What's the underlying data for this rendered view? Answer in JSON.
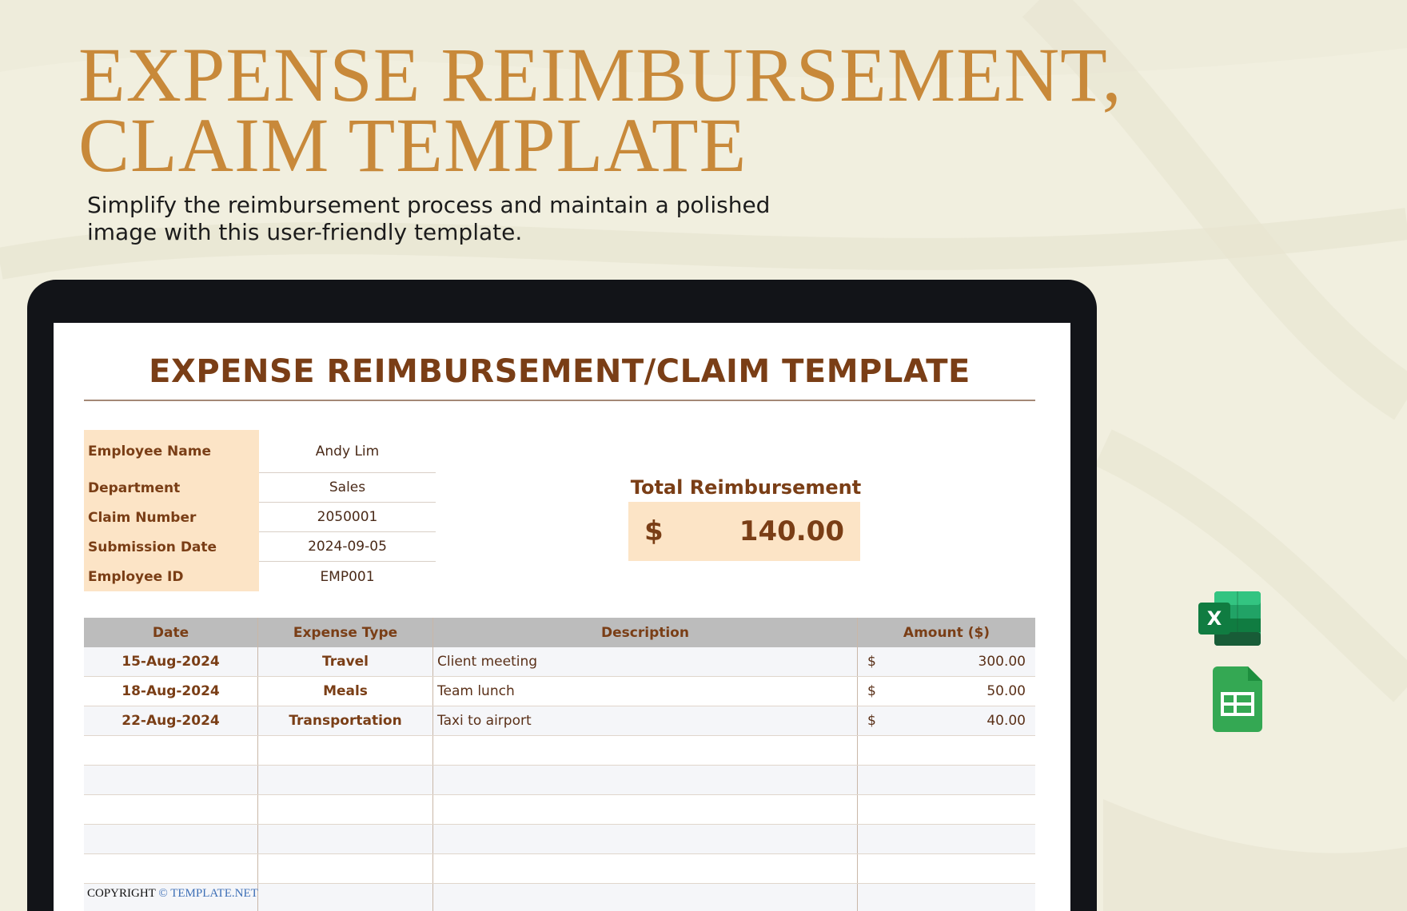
{
  "hero": {
    "title_line1": "EXPENSE REIMBURSEMENT,",
    "title_line2": "CLAIM TEMPLATE",
    "subtitle": "Simplify the reimbursement process and maintain a polished image with this user-friendly template."
  },
  "sheet": {
    "title": "EXPENSE REIMBURSEMENT/CLAIM TEMPLATE",
    "info": [
      {
        "label": "Employee Name",
        "value": "Andy Lim"
      },
      {
        "label": "Department",
        "value": "Sales"
      },
      {
        "label": "Claim Number",
        "value": "2050001"
      },
      {
        "label": "Submission Date",
        "value": "2024-09-05"
      },
      {
        "label": "Employee ID",
        "value": "EMP001"
      }
    ],
    "total": {
      "label": "Total Reimbursement",
      "currency": "$",
      "amount": "140.00"
    },
    "table": {
      "headers": [
        "Date",
        "Expense Type",
        "Description",
        "Amount ($)"
      ],
      "rows": [
        {
          "date": "15-Aug-2024",
          "type": "Travel",
          "description": "Client meeting",
          "currency": "$",
          "amount": "300.00"
        },
        {
          "date": "18-Aug-2024",
          "type": "Meals",
          "description": "Team lunch",
          "currency": "$",
          "amount": "50.00"
        },
        {
          "date": "22-Aug-2024",
          "type": "Transportation",
          "description": "Taxi to airport",
          "currency": "$",
          "amount": "40.00"
        }
      ]
    },
    "copyright": {
      "prefix": "COPYRIGHT",
      "brand": "© TEMPLATE.NET"
    }
  },
  "icons": {
    "excel": {
      "name": "excel-icon",
      "letter": "X"
    },
    "sheets": {
      "name": "google-sheets-icon"
    }
  },
  "colors": {
    "accent_gold": "#c8893a",
    "brown": "#7a3e16",
    "peach": "#fce4c6",
    "background": "#f1efdf"
  }
}
